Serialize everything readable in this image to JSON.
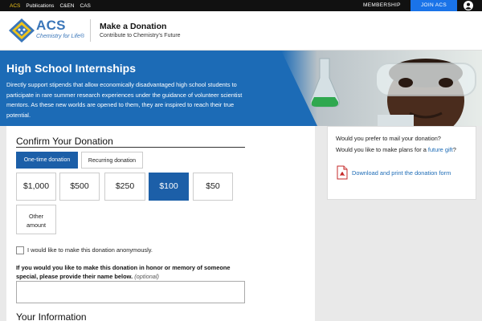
{
  "topbar": {
    "links": [
      "ACS",
      "Publications",
      "C&EN",
      "CAS"
    ],
    "membership": "MEMBERSHIP",
    "join": "JOIN ACS",
    "icon": "user-icon"
  },
  "header": {
    "acs": "ACS",
    "tagline": "Chemistry for Life®",
    "title": "Make a Donation",
    "subtitle": "Contribute to Chemistry's Future"
  },
  "hero": {
    "title": "High School Internships",
    "text": "Directly support stipends that allow economically disadvantaged high school students to participate in rare summer research experiences under the guidance of volunteer scientist mentors. As these new worlds are opened to them, they are inspired to reach their true potential."
  },
  "donation": {
    "title": "Confirm Your Donation",
    "tabs": {
      "one_time": "One-time donation",
      "recurring": "Recurring donation"
    },
    "amounts": [
      "$1,000",
      "$500",
      "$250",
      "$100",
      "$50"
    ],
    "selected_amount": "$100",
    "other_line1": "Other",
    "other_line2": "amount",
    "anonymous_label": "I would like to make this donation anonymously.",
    "honor_label": "If you would you like to make this donation in honor or memory of someone special, please provide their name below.",
    "honor_optional": "(optional)",
    "your_info": "Your Information"
  },
  "side": {
    "question1": "Would you prefer to mail your donation?",
    "question2_prefix": "Would you like to make plans for a ",
    "question2_link": "future gift",
    "question2_suffix": "?",
    "pdf_link": "Download and print the donation form"
  },
  "colors": {
    "accent_blue": "#1c6bb6",
    "selected_blue": "#1c5fa8",
    "join_blue": "#1a73e8",
    "active_link": "#f0c419"
  }
}
